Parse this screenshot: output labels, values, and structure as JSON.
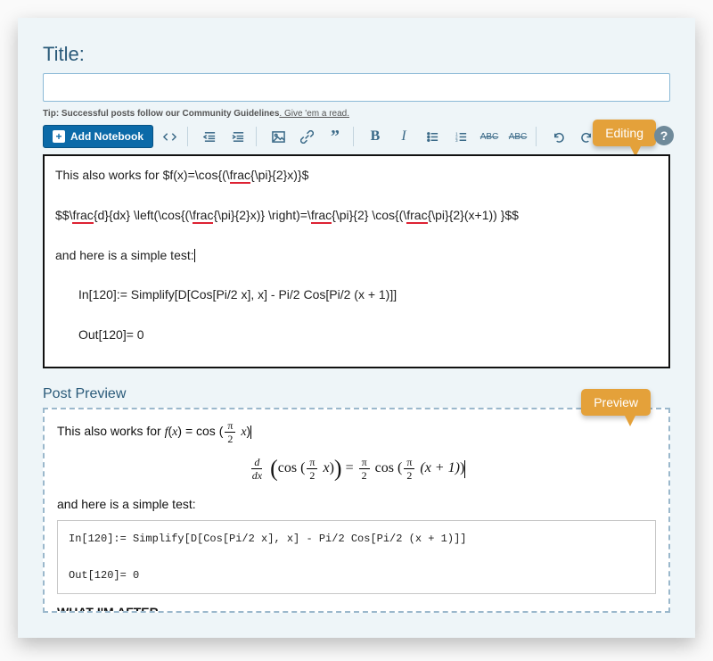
{
  "title": {
    "label": "Title:",
    "value": ""
  },
  "tip": {
    "prefix": "Tip: Successful posts follow our Community Guidelines",
    "link": ". Give 'em a read."
  },
  "toolbar": {
    "add_notebook": "Add Notebook",
    "help_glyph": "?"
  },
  "bubbles": {
    "editing": "Editing",
    "preview": "Preview"
  },
  "editor": {
    "line1_pre": "This also works for $f(x)=\\cos{(\\",
    "line1_u1": "frac",
    "line1_mid1": "{\\pi}{2}x)}$",
    "line2_a": "$$\\",
    "line2_u1": "frac",
    "line2_b": "{d}{dx} \\left(\\cos{(\\",
    "line2_u2": "frac",
    "line2_c": "{\\pi}{2}x)} \\right)=\\",
    "line2_u3": "frac",
    "line2_d": "{\\pi}{2} \\cos{(\\",
    "line2_u4": "frac",
    "line2_e": "{\\pi}{2}(x+1)) }$$",
    "line3": "and here is a simple test:",
    "code1": "In[120]:= Simplify[D[Cos[Pi/2 x], x] - Pi/2 Cos[Pi/2 (x + 1)]]",
    "code2": "Out[120]= 0"
  },
  "preview": {
    "heading": "Post Preview",
    "line1_text": "This also works for ",
    "line3": "and here is a simple test:",
    "code1": "In[120]:= Simplify[D[Cos[Pi/2 x], x] - Pi/2 Cos[Pi/2 (x + 1)]]",
    "code2": "Out[120]= 0",
    "what_after": "WHAT I'M AFTER",
    "math": {
      "f": "f",
      "x": "x",
      "cos": "cos",
      "pi": "π",
      "d": "d",
      "dx": "dx",
      "eq": "=",
      "two": "2",
      "plusone": "(x + 1)"
    }
  }
}
